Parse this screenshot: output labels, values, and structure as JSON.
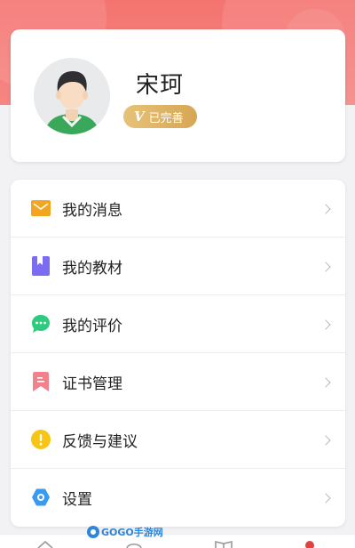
{
  "profile": {
    "name": "宋珂",
    "badge_letter": "V",
    "badge_text": "已完善"
  },
  "menu": {
    "items": [
      {
        "label": "我的消息",
        "icon": "mail-icon",
        "color": "#f2a51f"
      },
      {
        "label": "我的教材",
        "icon": "book-icon",
        "color": "#7b6cf2"
      },
      {
        "label": "我的评价",
        "icon": "chat-icon",
        "color": "#2ecb7f"
      },
      {
        "label": "证书管理",
        "icon": "bookmark-icon",
        "color": "#f3818c"
      },
      {
        "label": "反馈与建议",
        "icon": "alert-icon",
        "color": "#f6c614"
      },
      {
        "label": "设置",
        "icon": "gear-icon",
        "color": "#3a9af0"
      }
    ]
  },
  "watermark": {
    "text": "GOGO手游网"
  },
  "colors": {
    "header": "#f47470",
    "badge": "#d6a653"
  }
}
